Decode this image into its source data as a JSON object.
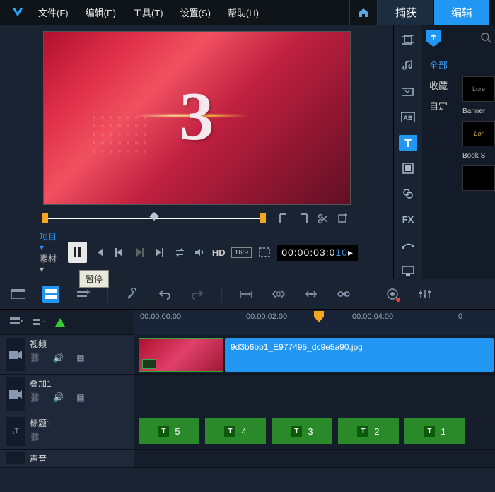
{
  "menu": {
    "file": "文件(F)",
    "edit": "编辑(E)",
    "tools": "工具(T)",
    "settings": "设置(S)",
    "help": "帮助(H)"
  },
  "top_tabs": {
    "capture": "捕获",
    "edit": "编辑"
  },
  "preview": {
    "countdown": "3",
    "tab_project": "项目",
    "tab_project_suffix": "▾",
    "tab_clip": "素材",
    "tab_clip_suffix": "▾",
    "hd": "HD",
    "ratio": "16:9",
    "timecode_main": "00:00:03:0",
    "timecode_frame": "10"
  },
  "tooltip": {
    "pause": "暂停"
  },
  "side": {
    "filter_all": "全部",
    "filter_fav": "收藏",
    "filter_auto": "自定",
    "thumb1": "Lore",
    "thumb1_label": "Banner",
    "thumb2": "Lor",
    "thumb2_label": "Book S",
    "fx": "FX"
  },
  "ruler": {
    "t0": "00:00:00:00",
    "t1": "00:00:02:00",
    "t2": "00:00:04:00",
    "t3": "0"
  },
  "tracks": {
    "video": {
      "name": "视频"
    },
    "overlay": {
      "name": "叠加1"
    },
    "title": {
      "name": "标题1"
    },
    "audio": {
      "name": "声音"
    }
  },
  "clips": {
    "image_name": "9d3b6bb1_E977495_dc9e5a90.jpg",
    "titles": [
      "5",
      "4",
      "3",
      "2",
      "1"
    ]
  }
}
